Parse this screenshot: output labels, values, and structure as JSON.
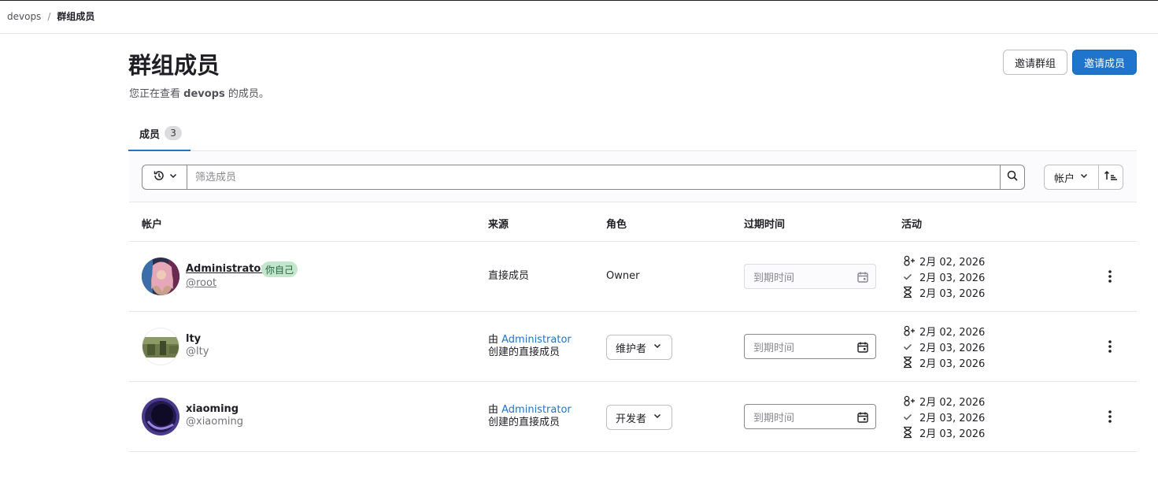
{
  "breadcrumb": {
    "group": "devops",
    "separator": "/",
    "current": "群组成员"
  },
  "page": {
    "title": "群组成员",
    "subtitle_prefix": "您正在查看 ",
    "subtitle_group": "devops",
    "subtitle_suffix": " 的成员。",
    "invite_group_label": "邀请群组",
    "invite_member_label": "邀请成员"
  },
  "tabs": [
    {
      "label": "成员",
      "count": "3"
    }
  ],
  "filter": {
    "placeholder": "筛选成员",
    "sort_label": "帐户"
  },
  "table": {
    "headers": {
      "account": "帐户",
      "source": "来源",
      "role": "角色",
      "expiration": "过期时间",
      "activity": "活动"
    },
    "rows": [
      {
        "name": "Administrator",
        "username": "@root",
        "badge": "你自己",
        "source": "直接成员",
        "role": "Owner",
        "expiration_placeholder": "到期时间",
        "activity": {
          "joined": "2月 02, 2026",
          "access_granted": "2月 03, 2026",
          "last_activity": "2月 03, 2026"
        }
      },
      {
        "name": "lty",
        "username": "@lty",
        "source_prefix": "由 ",
        "source_link": "Administrator",
        "source_suffix": "创建的直接成员",
        "role": "维护者",
        "expiration_placeholder": "到期时间",
        "activity": {
          "joined": "2月 02, 2026",
          "access_granted": "2月 03, 2026",
          "last_activity": "2月 03, 2026"
        }
      },
      {
        "name": "xiaoming",
        "username": "@xiaoming",
        "source_prefix": "由 ",
        "source_link": "Administrator",
        "source_suffix": "创建的直接成员",
        "role": "开发者",
        "expiration_placeholder": "到期时间",
        "activity": {
          "joined": "2月 02, 2026",
          "access_granted": "2月 03, 2026",
          "last_activity": "2月 03, 2026"
        }
      }
    ]
  },
  "icons": [
    "history-icon",
    "chevron-down-icon",
    "search-icon",
    "sort-ascending-icon",
    "calendar-icon",
    "user-add-icon",
    "check-icon",
    "hourglass-icon",
    "kebab-icon"
  ],
  "colors": {
    "primary": "#1f75cb",
    "badge_bg": "#c3e6cd",
    "badge_text": "#24663b",
    "text": "#1f1e24",
    "muted": "#737278"
  }
}
